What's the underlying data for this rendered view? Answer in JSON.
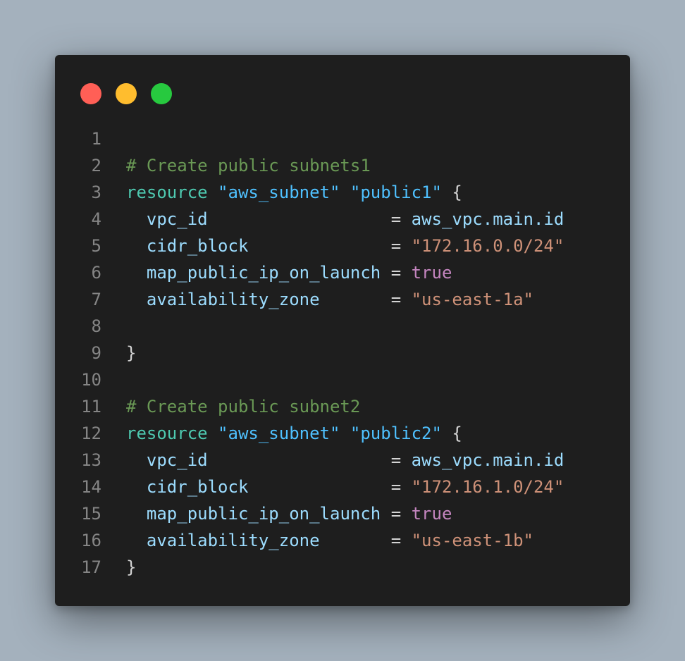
{
  "colors": {
    "background": "#a4b1bd",
    "window": "#1e1e1e",
    "dot_red": "#ff5f56",
    "dot_yellow": "#ffbd2e",
    "dot_green": "#27c93f"
  },
  "window_controls": [
    {
      "name": "close-dot",
      "color": "#ff5f56"
    },
    {
      "name": "minimize-dot",
      "color": "#ffbd2e"
    },
    {
      "name": "maximize-dot",
      "color": "#27c93f"
    }
  ],
  "code_lines": [
    {
      "number": "1",
      "tokens": []
    },
    {
      "number": "2",
      "tokens": [
        {
          "t": "comment",
          "v": "# Create public subnets1"
        }
      ]
    },
    {
      "number": "3",
      "tokens": [
        {
          "t": "keyword",
          "v": "resource"
        },
        {
          "t": "plain",
          "v": " "
        },
        {
          "t": "label",
          "v": "\"aws_subnet\""
        },
        {
          "t": "plain",
          "v": " "
        },
        {
          "t": "label",
          "v": "\"public1\""
        },
        {
          "t": "plain",
          "v": " {"
        }
      ]
    },
    {
      "number": "4",
      "tokens": [
        {
          "t": "plain",
          "v": "  "
        },
        {
          "t": "attr",
          "v": "vpc_id"
        },
        {
          "t": "plain",
          "v": "                  = "
        },
        {
          "t": "attr",
          "v": "aws_vpc.main.id"
        }
      ]
    },
    {
      "number": "5",
      "tokens": [
        {
          "t": "plain",
          "v": "  "
        },
        {
          "t": "attr",
          "v": "cidr_block"
        },
        {
          "t": "plain",
          "v": "              = "
        },
        {
          "t": "string",
          "v": "\"172.16.0.0/24\""
        }
      ]
    },
    {
      "number": "6",
      "tokens": [
        {
          "t": "plain",
          "v": "  "
        },
        {
          "t": "attr",
          "v": "map_public_ip_on_launch"
        },
        {
          "t": "plain",
          "v": " = "
        },
        {
          "t": "bool",
          "v": "true"
        }
      ]
    },
    {
      "number": "7",
      "tokens": [
        {
          "t": "plain",
          "v": "  "
        },
        {
          "t": "attr",
          "v": "availability_zone"
        },
        {
          "t": "plain",
          "v": "       = "
        },
        {
          "t": "string",
          "v": "\"us-east-1a\""
        }
      ]
    },
    {
      "number": "8",
      "tokens": []
    },
    {
      "number": "9",
      "tokens": [
        {
          "t": "plain",
          "v": "}"
        }
      ]
    },
    {
      "number": "10",
      "tokens": []
    },
    {
      "number": "11",
      "tokens": [
        {
          "t": "comment",
          "v": "# Create public subnet2"
        }
      ]
    },
    {
      "number": "12",
      "tokens": [
        {
          "t": "keyword",
          "v": "resource"
        },
        {
          "t": "plain",
          "v": " "
        },
        {
          "t": "label",
          "v": "\"aws_subnet\""
        },
        {
          "t": "plain",
          "v": " "
        },
        {
          "t": "label",
          "v": "\"public2\""
        },
        {
          "t": "plain",
          "v": " {"
        }
      ]
    },
    {
      "number": "13",
      "tokens": [
        {
          "t": "plain",
          "v": "  "
        },
        {
          "t": "attr",
          "v": "vpc_id"
        },
        {
          "t": "plain",
          "v": "                  = "
        },
        {
          "t": "attr",
          "v": "aws_vpc.main.id"
        }
      ]
    },
    {
      "number": "14",
      "tokens": [
        {
          "t": "plain",
          "v": "  "
        },
        {
          "t": "attr",
          "v": "cidr_block"
        },
        {
          "t": "plain",
          "v": "              = "
        },
        {
          "t": "string",
          "v": "\"172.16.1.0/24\""
        }
      ]
    },
    {
      "number": "15",
      "tokens": [
        {
          "t": "plain",
          "v": "  "
        },
        {
          "t": "attr",
          "v": "map_public_ip_on_launch"
        },
        {
          "t": "plain",
          "v": " = "
        },
        {
          "t": "bool",
          "v": "true"
        }
      ]
    },
    {
      "number": "16",
      "tokens": [
        {
          "t": "plain",
          "v": "  "
        },
        {
          "t": "attr",
          "v": "availability_zone"
        },
        {
          "t": "plain",
          "v": "       = "
        },
        {
          "t": "string",
          "v": "\"us-east-1b\""
        }
      ]
    },
    {
      "number": "17",
      "tokens": [
        {
          "t": "plain",
          "v": "}"
        }
      ]
    }
  ]
}
